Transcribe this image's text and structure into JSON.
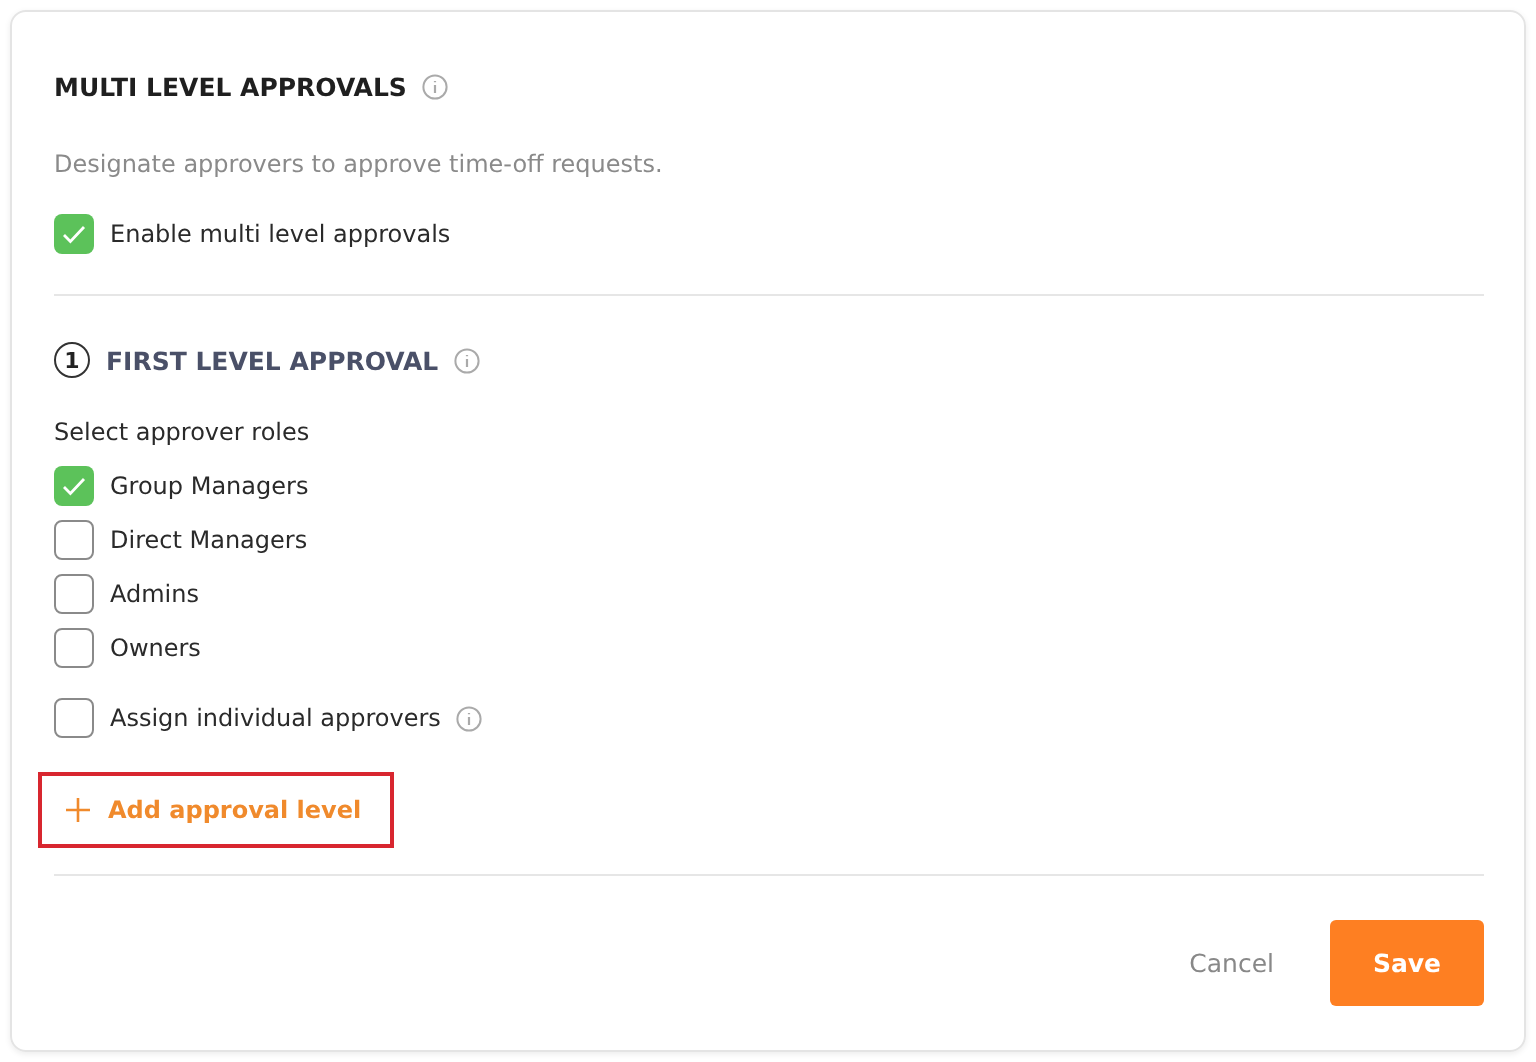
{
  "title": "MULTI LEVEL APPROVALS",
  "description": "Designate approvers to approve time-off requests.",
  "enable": {
    "label": "Enable multi level approvals",
    "checked": true
  },
  "level": {
    "number": "1",
    "title": "FIRST LEVEL APPROVAL",
    "roles_label": "Select approver roles",
    "roles": [
      {
        "label": "Group Managers",
        "checked": true
      },
      {
        "label": "Direct Managers",
        "checked": false
      },
      {
        "label": "Admins",
        "checked": false
      },
      {
        "label": "Owners",
        "checked": false
      }
    ],
    "individual": {
      "label": "Assign individual approvers",
      "checked": false
    }
  },
  "add_button": {
    "label": "Add approval level",
    "highlighted": true
  },
  "buttons": {
    "cancel": "Cancel",
    "save": "Save"
  }
}
